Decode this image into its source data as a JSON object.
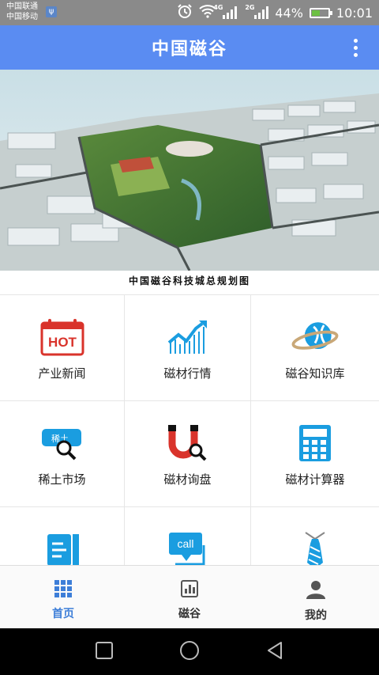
{
  "status_bar": {
    "carrier_1": "中国联通",
    "carrier_2": "中国移动",
    "signal_1_label": "4G",
    "signal_2_label": "2G",
    "battery": "44%",
    "time": "10:01",
    "icons": [
      "usb-icon",
      "alarm-icon",
      "wifi-icon",
      "signal-icon",
      "battery-icon"
    ]
  },
  "app_bar": {
    "title": "中国磁谷",
    "menu_icon": "more-vertical-icon"
  },
  "banner": {
    "caption": "中国磁谷科技城总规划图",
    "image": "aerial-plan-image"
  },
  "grid": {
    "items": [
      {
        "label": "产业新闻",
        "icon": "hot-calendar-icon",
        "icon_text": "HOT"
      },
      {
        "label": "磁材行情",
        "icon": "trend-chart-icon"
      },
      {
        "label": "磁谷知识库",
        "icon": "globe-icon"
      },
      {
        "label": "稀土市场",
        "icon": "rare-earth-search-icon",
        "icon_text": "稀土"
      },
      {
        "label": "磁材询盘",
        "icon": "magnet-search-icon"
      },
      {
        "label": "磁材计算器",
        "icon": "calculator-icon"
      },
      {
        "label": "",
        "icon": "book-icon"
      },
      {
        "label": "",
        "icon": "call-icon",
        "icon_text": "call"
      },
      {
        "label": "",
        "icon": "tie-icon"
      }
    ]
  },
  "tab_bar": {
    "tabs": [
      {
        "label": "首页",
        "icon": "grid-icon",
        "active": true
      },
      {
        "label": "磁谷",
        "icon": "bar-chart-icon",
        "active": false
      },
      {
        "label": "我的",
        "icon": "user-icon",
        "active": false
      }
    ]
  },
  "nav_bar": {
    "buttons": [
      "recents-button",
      "home-button",
      "back-button"
    ]
  },
  "colors": {
    "primary": "#5a8cf2",
    "accent": "#3d7ed8",
    "icon_blue": "#1a9de0",
    "hot_red": "#d9332b"
  }
}
